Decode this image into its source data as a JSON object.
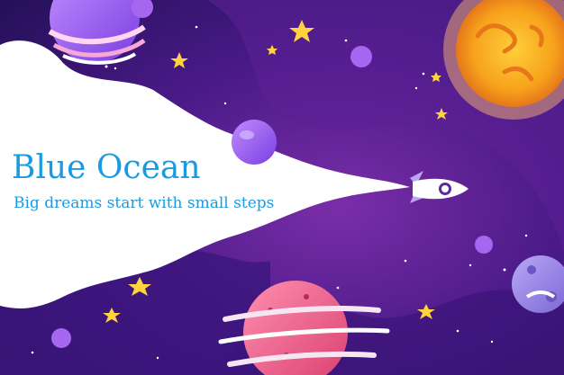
{
  "hero": {
    "title": "Blue Ocean",
    "subtitle": "Big dreams start with small steps"
  },
  "illustration": {
    "theme": "outer-space",
    "icons": [
      "rocket-icon",
      "sun-icon",
      "ringed-planet-icon",
      "moon-icon",
      "star-icon"
    ]
  },
  "colors": {
    "text_accent": "#1a9be0",
    "space_dark": "#2b0f5e",
    "space_mid": "#5a1f8f",
    "banner_white": "#ffffff",
    "sun_orange": "#f7a21b",
    "star_yellow": "#ffd23f"
  }
}
